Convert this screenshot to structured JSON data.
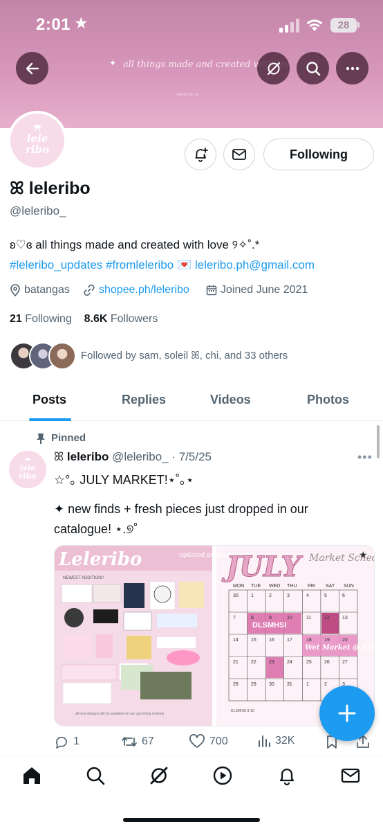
{
  "status_bar": {
    "time": "2:01",
    "battery": "28"
  },
  "banner": {
    "tagline": "all things made and created with love",
    "credit": "leleribo by ruri"
  },
  "profile": {
    "avatar_text": "lele ribo",
    "display_name": "leleribo",
    "name_prefix": "ꕤ",
    "handle": "@leleribo_",
    "following_label": "Following",
    "bio_line1": "ʚ♡ɞ all things made and created with love ୨✧˚.*",
    "bio_hashtag1": "#leleribo_updates",
    "bio_hashtag2": "#fromleleribo",
    "bio_email": "leleribo.ph@gmail.com",
    "location": "batangas",
    "website": "shopee.ph/leleribo",
    "joined": "Joined June 2021",
    "following_count": "21",
    "following_text": "Following",
    "followers_count": "8.6K",
    "followers_text": "Followers",
    "followed_by": "Followed by sam, soleil ꕤ, chi, and 33 others"
  },
  "tabs": [
    {
      "label": "Posts"
    },
    {
      "label": "Replies"
    },
    {
      "label": "Videos"
    },
    {
      "label": "Photos"
    }
  ],
  "post": {
    "pinned_label": "Pinned",
    "author_name": "leleribo",
    "author_meta": "@leleribo_ · 7/5/25",
    "text_line1": "☆°｡ JULY MARKET!⋆˚｡⋆",
    "text_line2": "✦ new finds + fresh pieces just dropped in our",
    "text_line3": "catalogue! ⋆.୭˚",
    "media": {
      "left_title": "Leleribo",
      "left_subtitle": "updated products",
      "newest_label": "NEWEST ADDITION!!",
      "right_title": "JULY",
      "right_subtitle": "Market Schedule",
      "days": [
        "MON",
        "TUE",
        "WED",
        "THU",
        "FRI",
        "SAT",
        "SUN"
      ],
      "event_dls": "DLSMHSI",
      "event_wet": "Wet Market @ ATC"
    },
    "stats": {
      "replies": "1",
      "reposts": "67",
      "likes": "700",
      "views": "32K"
    }
  },
  "colors": {
    "accent": "#1d9bf0",
    "banner": "#d796bb",
    "text": "#0f1419",
    "muted": "#536471"
  }
}
